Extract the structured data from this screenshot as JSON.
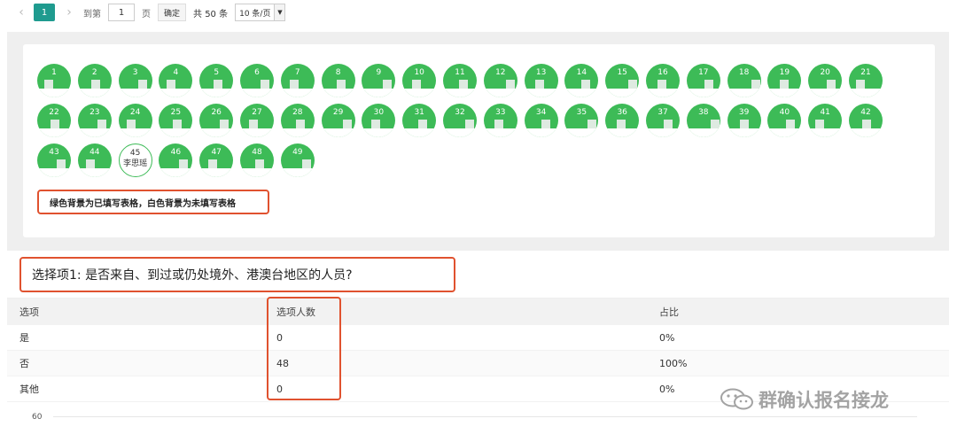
{
  "pagination": {
    "prev_icon": "chevron-left-icon",
    "next_icon": "chevron-right-icon",
    "current_page": "1",
    "goto_label": "到第",
    "goto_value": "1",
    "page_unit": "页",
    "confirm_label": "确定",
    "total_text": "共 50 条",
    "page_size": "10 条/页"
  },
  "participants": [
    {
      "num": "1",
      "filled": true
    },
    {
      "num": "2",
      "filled": true
    },
    {
      "num": "3",
      "filled": true
    },
    {
      "num": "4",
      "filled": true
    },
    {
      "num": "5",
      "filled": true
    },
    {
      "num": "6",
      "filled": true
    },
    {
      "num": "7",
      "filled": true
    },
    {
      "num": "8",
      "filled": true
    },
    {
      "num": "9",
      "filled": true
    },
    {
      "num": "10",
      "filled": true
    },
    {
      "num": "11",
      "filled": true
    },
    {
      "num": "12",
      "filled": true
    },
    {
      "num": "13",
      "filled": true
    },
    {
      "num": "14",
      "filled": true
    },
    {
      "num": "15",
      "filled": true
    },
    {
      "num": "16",
      "filled": true
    },
    {
      "num": "17",
      "filled": true
    },
    {
      "num": "18",
      "filled": true
    },
    {
      "num": "19",
      "filled": true
    },
    {
      "num": "20",
      "filled": true
    },
    {
      "num": "21",
      "filled": true
    },
    {
      "num": "22",
      "filled": true
    },
    {
      "num": "23",
      "filled": true
    },
    {
      "num": "24",
      "filled": true
    },
    {
      "num": "25",
      "filled": true
    },
    {
      "num": "26",
      "filled": true
    },
    {
      "num": "27",
      "filled": true
    },
    {
      "num": "28",
      "filled": true
    },
    {
      "num": "29",
      "filled": true
    },
    {
      "num": "30",
      "filled": true
    },
    {
      "num": "31",
      "filled": true
    },
    {
      "num": "32",
      "filled": true
    },
    {
      "num": "33",
      "filled": true
    },
    {
      "num": "34",
      "filled": true
    },
    {
      "num": "35",
      "filled": true
    },
    {
      "num": "36",
      "filled": true
    },
    {
      "num": "37",
      "filled": true
    },
    {
      "num": "38",
      "filled": true
    },
    {
      "num": "39",
      "filled": true
    },
    {
      "num": "40",
      "filled": true
    },
    {
      "num": "41",
      "filled": true
    },
    {
      "num": "42",
      "filled": true
    },
    {
      "num": "43",
      "filled": true
    },
    {
      "num": "44",
      "filled": true
    },
    {
      "num": "45",
      "filled": false,
      "name": "李思瑶"
    },
    {
      "num": "46",
      "filled": true
    },
    {
      "num": "47",
      "filled": true
    },
    {
      "num": "48",
      "filled": true
    },
    {
      "num": "49",
      "filled": true
    }
  ],
  "legend_note": "绿色背景为已填写表格，白色背景为未填写表格",
  "question": "选择项1: 是否来自、到过或仍处境外、港澳台地区的人员?",
  "table": {
    "headers": [
      "选项",
      "选项人数",
      "占比"
    ],
    "rows": [
      {
        "option": "是",
        "count": "0",
        "ratio": "0%"
      },
      {
        "option": "否",
        "count": "48",
        "ratio": "100%"
      },
      {
        "option": "其他",
        "count": "0",
        "ratio": "0%"
      }
    ]
  },
  "chart_axis_tick": "60",
  "watermark": "群确认报名接龙",
  "colors": {
    "filled": "#3dbb57",
    "highlight": "#e0522f",
    "pager_active": "#1f9b8f"
  }
}
